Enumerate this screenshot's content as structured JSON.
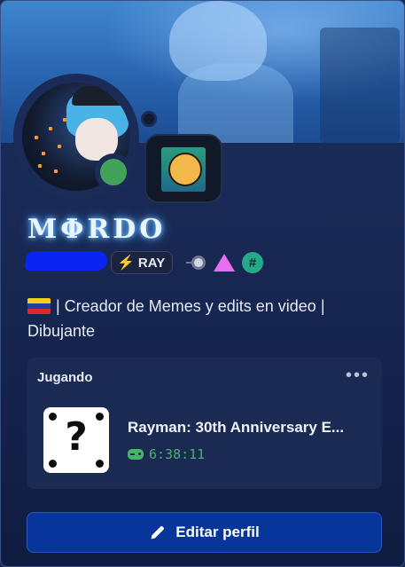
{
  "profile": {
    "display_name": "MΦRDO",
    "tag": {
      "icon": "lightning-bolt-icon",
      "label": "RAY"
    },
    "badges": [
      "speed-disc-icon",
      "pink-triangle-icon",
      "hash-icon"
    ],
    "bio_line": "| Creador de Memes y edits en video | Dibujante",
    "bio_flag": "venezuela-flag-icon",
    "status": "online"
  },
  "activity": {
    "header": "Jugando",
    "more_label": "•••",
    "game_title": "Rayman: 30th Anniversary E...",
    "elapsed": "6:38:11",
    "game_icon": "unknown-game-question-icon",
    "timer_icon": "gamepad-icon"
  },
  "actions": {
    "edit_label": "Editar perfil",
    "edit_icon": "pencil-icon"
  },
  "colors": {
    "status_online": "#43a25a",
    "accent_button": "#06369a",
    "timer_green": "#46b46a",
    "name_glow": "#7fc4ff"
  }
}
